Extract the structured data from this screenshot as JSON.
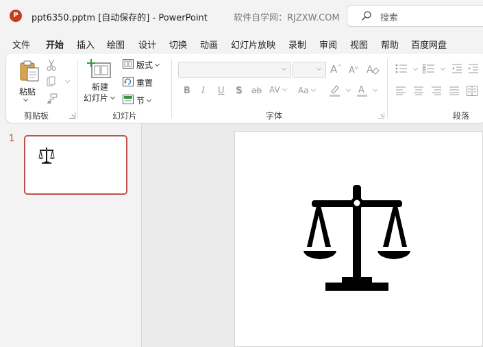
{
  "titlebar": {
    "app_logo": "P",
    "doc_title": "ppt6350.pptm [自动保存的]  -  PowerPoint",
    "watermark": "软件自学网：RJZXW.COM",
    "search_placeholder": "搜索"
  },
  "menu": {
    "tabs": [
      "文件",
      "开始",
      "插入",
      "绘图",
      "设计",
      "切换",
      "动画",
      "幻灯片放映",
      "录制",
      "审阅",
      "视图",
      "帮助",
      "百度网盘"
    ],
    "active": "开始"
  },
  "ribbon": {
    "clipboard": {
      "paste": "粘贴",
      "label": "剪贴板"
    },
    "slides": {
      "new_slide_1": "新建",
      "new_slide_2": "幻灯片",
      "layout": "版式",
      "reset": "重置",
      "section": "节",
      "label": "幻灯片"
    },
    "font": {
      "bold": "B",
      "italic": "I",
      "underline": "U",
      "shadow": "S",
      "strike": "ab",
      "spacing": "AV",
      "case": "Aa",
      "grow": "A",
      "shrink": "A",
      "label": "字体"
    },
    "paragraph": {
      "label": "段落"
    }
  },
  "slides_pane": {
    "slide_number": "1"
  },
  "colors": {
    "accent": "#c43e1c",
    "selection_border": "#c0504d"
  },
  "icons": [
    "search-icon",
    "paste-icon",
    "cut-icon",
    "copy-icon",
    "format-painter-icon",
    "new-slide-icon",
    "layout-icon",
    "reset-icon",
    "section-icon",
    "balance-scale-icon"
  ]
}
